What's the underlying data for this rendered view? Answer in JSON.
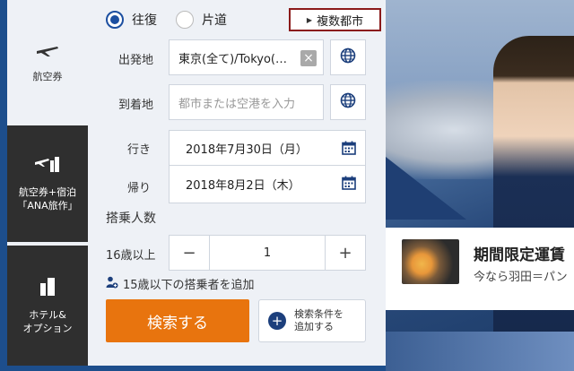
{
  "sidebar": {
    "items": [
      {
        "label": "航空券"
      },
      {
        "label": "航空券+宿泊\n「ANA旅作」"
      },
      {
        "label": "ホテル&\nオプション"
      }
    ]
  },
  "trip_type": {
    "round_trip": "往復",
    "one_way": "片道",
    "multi_city": "複数都市"
  },
  "origin": {
    "label": "出発地",
    "value": "東京(全て)/Tokyo(…"
  },
  "destination": {
    "label": "到着地",
    "placeholder": "都市または空港を入力"
  },
  "outbound": {
    "label": "行き",
    "value": "2018年7月30日（月）"
  },
  "return": {
    "label": "帰り",
    "value": "2018年8月2日（木）"
  },
  "passengers": {
    "section_label": "搭乗人数",
    "adult_label": "16歳以上",
    "minus": "−",
    "plus": "+",
    "count": "1"
  },
  "add_child": "15歳以下の搭乗者を追加",
  "search_button": "検索する",
  "add_conditions": "検索条件を\n追加する",
  "promo": {
    "title": "期間限定運賃",
    "subtitle": "今なら羽田＝パン"
  },
  "colors": {
    "accent_orange": "#e8740e",
    "brand_navy": "#1c3f7c",
    "sidebar_dark": "#2f2f2f",
    "highlight_border": "#8b1a1a"
  }
}
